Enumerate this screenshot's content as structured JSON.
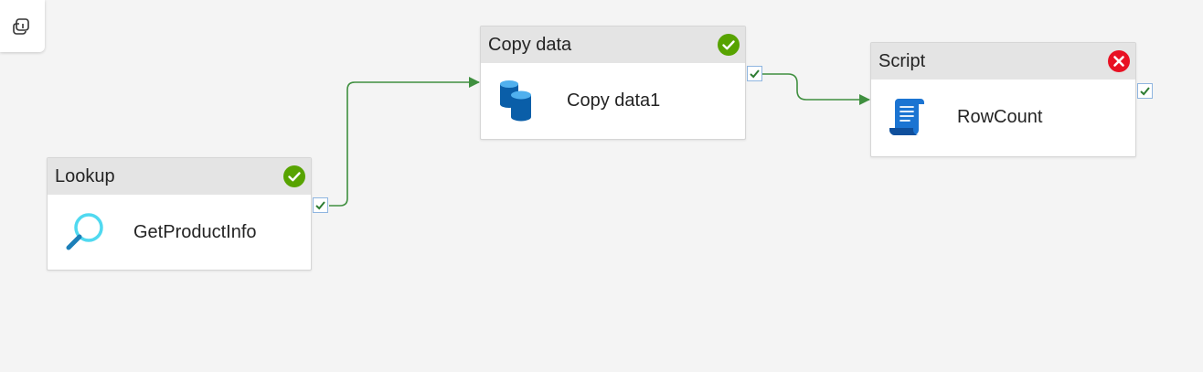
{
  "colors": {
    "canvas_bg": "#f4f4f4",
    "header_bg": "#e4e4e4",
    "success_green": "#57a300",
    "connector_green": "#3f8f3f",
    "failure_red": "#e81123",
    "port_border": "#8fb5e0"
  },
  "toolbar": {
    "copilot_icon": "copilot-icon"
  },
  "activities": [
    {
      "type": "Lookup",
      "name": "GetProductInfo",
      "icon": "magnifier-icon",
      "status": "succeeded",
      "status_icon": "success-check-icon"
    },
    {
      "type": "Copy data",
      "name": "Copy data1",
      "icon": "database-copy-icon",
      "status": "succeeded",
      "status_icon": "success-check-icon"
    },
    {
      "type": "Script",
      "name": "RowCount",
      "icon": "script-scroll-icon",
      "status": "failed",
      "status_icon": "failure-x-icon"
    }
  ],
  "connections": [
    {
      "from": "GetProductInfo",
      "to": "Copy data1",
      "condition": "Succeeded"
    },
    {
      "from": "Copy data1",
      "to": "RowCount",
      "condition": "Succeeded"
    }
  ]
}
